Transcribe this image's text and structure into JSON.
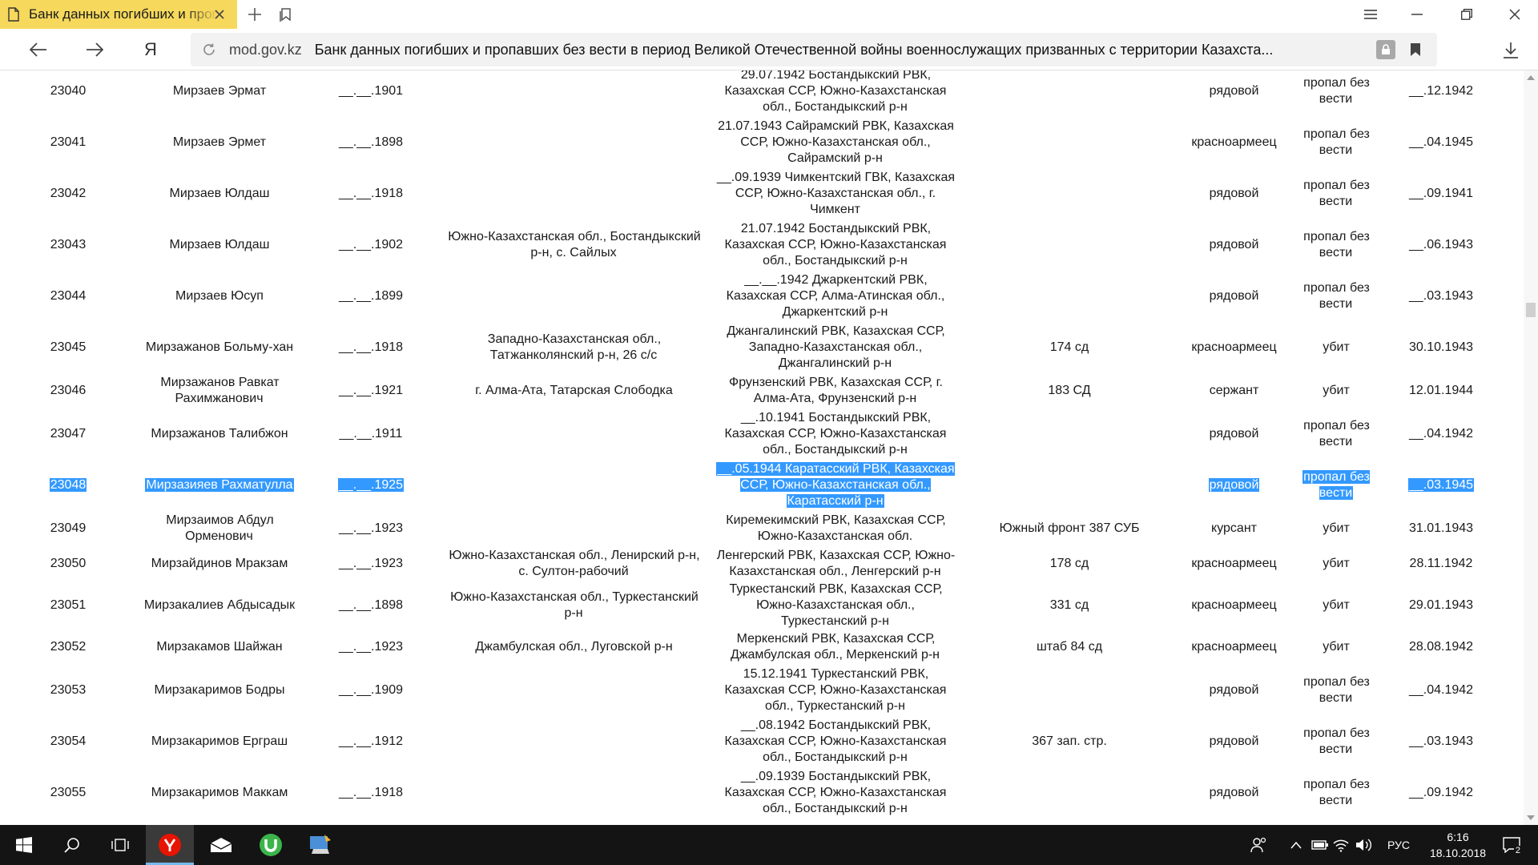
{
  "browser": {
    "tab_title": "Банк данных погибших и пропавших без вести в период Великой Отечественной войны",
    "domain": "mod.gov.kz",
    "page_title": "Банк данных погибших и пропавших без вести в период Великой Отечественной войны военнослужащих призванных с территории Казахста...",
    "brand_glyph": "Я"
  },
  "records": [
    {
      "id": "23040",
      "name": "Мирзаев Эрмат",
      "birth": "__.__.1901",
      "birthplace": "",
      "conscription": "29.07.1942 Бостандыкский РВК, Казахская ССР, Южно-Казахстанская обл., Бостандыкский р-н",
      "unit": "",
      "rank": "рядовой",
      "fate": "пропал без вести",
      "date": "__.12.1942"
    },
    {
      "id": "23041",
      "name": "Мирзаев Эрмет",
      "birth": "__.__.1898",
      "birthplace": "",
      "conscription": "21.07.1943 Сайрамский РВК, Казахская ССР, Южно-Казахстанская обл., Сайрамский р-н",
      "unit": "",
      "rank": "красноармеец",
      "fate": "пропал без вести",
      "date": "__.04.1945"
    },
    {
      "id": "23042",
      "name": "Мирзаев Юлдаш",
      "birth": "__.__.1918",
      "birthplace": "",
      "conscription": "__.09.1939 Чимкентский ГВК, Казахская ССР, Южно-Казахстанская обл., г. Чимкент",
      "unit": "",
      "rank": "рядовой",
      "fate": "пропал без вести",
      "date": "__.09.1941"
    },
    {
      "id": "23043",
      "name": "Мирзаев Юлдаш",
      "birth": "__.__.1902",
      "birthplace": "Южно-Казахстанская обл., Бостандыкский р-н, с. Сайлых",
      "conscription": "21.07.1942 Бостандыкский РВК, Казахская ССР, Южно-Казахстанская обл., Бостандыкский р-н",
      "unit": "",
      "rank": "рядовой",
      "fate": "пропал без вести",
      "date": "__.06.1943"
    },
    {
      "id": "23044",
      "name": "Мирзаев Юсуп",
      "birth": "__.__.1899",
      "birthplace": "",
      "conscription": "__.__.1942 Джаркентский РВК, Казахская ССР, Алма-Атинская обл., Джаркентский р-н",
      "unit": "",
      "rank": "рядовой",
      "fate": "пропал без вести",
      "date": "__.03.1943"
    },
    {
      "id": "23045",
      "name": "Мирзажанов Больму-хан",
      "birth": "__.__.1918",
      "birthplace": "Западно-Казахстанская обл., Татжанколянский р-н, 26 с/с",
      "conscription": "Джангалинский РВК, Казахская ССР, Западно-Казахстанская обл., Джангалинский р-н",
      "unit": "174 сд",
      "rank": "красноармеец",
      "fate": "убит",
      "date": "30.10.1943"
    },
    {
      "id": "23046",
      "name": "Мирзажанов Равкат Рахимжанович",
      "birth": "__.__.1921",
      "birthplace": "г. Алма-Ата, Татарская Слободка",
      "conscription": "Фрунзенский РВК, Казахская ССР, г. Алма-Ата, Фрунзенский р-н",
      "unit": "183 СД",
      "rank": "сержант",
      "fate": "убит",
      "date": "12.01.1944"
    },
    {
      "id": "23047",
      "name": "Мирзажанов Талибжон",
      "birth": "__.__.1911",
      "birthplace": "",
      "conscription": "__.10.1941 Бостандыкский РВК, Казахская ССР, Южно-Казахстанская обл., Бостандыкский р-н",
      "unit": "",
      "rank": "рядовой",
      "fate": "пропал без вести",
      "date": "__.04.1942"
    },
    {
      "id": "23048",
      "name": "Мирзазияев Рахматулла",
      "birth": "__.__.1925",
      "birthplace": "",
      "conscription": "__.05.1944 Каратасский РВК, Казахская ССР, Южно-Казахстанская обл., Каратасский р-н",
      "unit": "",
      "rank": "рядовой",
      "fate": "пропал без вести",
      "date": "__.03.1945"
    },
    {
      "id": "23049",
      "name": "Мирзаимов Абдул Орменович",
      "birth": "__.__.1923",
      "birthplace": "",
      "conscription": "Киремекимский РВК, Казахская ССР, Южно-Казахстанская обл.",
      "unit": "Южный фронт 387 СУБ",
      "rank": "курсант",
      "fate": "убит",
      "date": "31.01.1943"
    },
    {
      "id": "23050",
      "name": "Мирзайдинов Мракзам",
      "birth": "__.__.1923",
      "birthplace": "Южно-Казахстанская обл., Ленирский р-н, с. Султон-рабочий",
      "conscription": "Ленгерский РВК, Казахская ССР, Южно-Казахстанская обл., Ленгерский р-н",
      "unit": "178 сд",
      "rank": "красноармеец",
      "fate": "убит",
      "date": "28.11.1942"
    },
    {
      "id": "23051",
      "name": "Мирзакалиев Абдысадык",
      "birth": "__.__.1898",
      "birthplace": "Южно-Казахстанская обл., Туркестанский р-н",
      "conscription": "Туркестанский РВК, Казахская ССР, Южно-Казахстанская обл., Туркестанский р-н",
      "unit": "331 сд",
      "rank": "красноармеец",
      "fate": "убит",
      "date": "29.01.1943"
    },
    {
      "id": "23052",
      "name": "Мирзакамов Шайжан",
      "birth": "__.__.1923",
      "birthplace": "Джамбулская обл., Луговской р-н",
      "conscription": "Меркенский РВК, Казахская ССР, Джамбулская обл., Меркенский р-н",
      "unit": "штаб 84 сд",
      "rank": "красноармеец",
      "fate": "убит",
      "date": "28.08.1942"
    },
    {
      "id": "23053",
      "name": "Мирзакаримов Бодры",
      "birth": "__.__.1909",
      "birthplace": "",
      "conscription": "15.12.1941 Туркестанский РВК, Казахская ССР, Южно-Казахстанская обл., Туркестанский р-н",
      "unit": "",
      "rank": "рядовой",
      "fate": "пропал без вести",
      "date": "__.04.1942"
    },
    {
      "id": "23054",
      "name": "Мирзакаримов Ерграш",
      "birth": "__.__.1912",
      "birthplace": "",
      "conscription": "__.08.1942 Бостандыкский РВК, Казахская ССР, Южно-Казахстанская обл., Бостандыкский р-н",
      "unit": "367 зап. стр.",
      "rank": "рядовой",
      "fate": "пропал без вести",
      "date": "__.03.1943"
    },
    {
      "id": "23055",
      "name": "Мирзакаримов Маккам",
      "birth": "__.__.1918",
      "birthplace": "",
      "conscription": "__.09.1939 Бостандыкский РВК, Казахская ССР, Южно-Казахстанская обл., Бостандыкский р-н",
      "unit": "",
      "rank": "рядовой",
      "fate": "пропал без вести",
      "date": "__.09.1942"
    }
  ],
  "selected_record": "23048",
  "taskbar": {
    "lang": "РУС",
    "time": "6:16",
    "date": "18.10.2018",
    "notifications": "2"
  },
  "colors": {
    "tab_active": "#f6d85c",
    "selection": "#3399ff",
    "taskbar": "#141414",
    "yandex_red": "#e61400",
    "utorrent_green": "#3bb54a"
  }
}
